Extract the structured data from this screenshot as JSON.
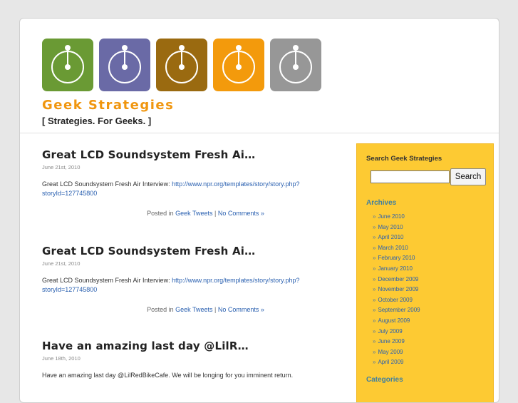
{
  "site": {
    "title": "Geek Strategies",
    "tagline": "[ Strategies. For Geeks. ]",
    "logo_colors": [
      "#6a9a34",
      "#6a6aa6",
      "#9a6a10",
      "#f39a0c",
      "#979797"
    ]
  },
  "posts": [
    {
      "title": "Great LCD Soundsystem Fresh Ai…",
      "date": "June 21st, 2010",
      "body_text": "Great LCD Soundsystem Fresh Air Interview: ",
      "body_link": "http://www.npr.org/templates/story/story.php?storyId=127745800",
      "meta_prefix": "Posted in ",
      "category": "Geek Tweets",
      "separator": " | ",
      "comments": "No Comments »"
    },
    {
      "title": "Great LCD Soundsystem Fresh Ai…",
      "date": "June 21st, 2010",
      "body_text": "Great LCD Soundsystem Fresh Air Interview: ",
      "body_link": "http://www.npr.org/templates/story/story.php?storyId=127745800",
      "meta_prefix": "Posted in ",
      "category": "Geek Tweets",
      "separator": " | ",
      "comments": "No Comments »"
    },
    {
      "title": "Have an amazing last day @LilR…",
      "date": "June 18th, 2010",
      "body_text": "Have an amazing last day @LilRedBikeCafe. We will be longing for you imminent return."
    }
  ],
  "sidebar": {
    "search_heading": "Search Geek Strategies",
    "search_button": "Search",
    "search_value": "",
    "archives_heading": "Archives",
    "archives": [
      "June 2010",
      "May 2010",
      "April 2010",
      "March 2010",
      "February 2010",
      "January 2010",
      "December 2009",
      "November 2009",
      "October 2009",
      "September 2009",
      "August 2009",
      "July 2009",
      "June 2009",
      "May 2009",
      "April 2009"
    ],
    "categories_heading": "Categories"
  }
}
